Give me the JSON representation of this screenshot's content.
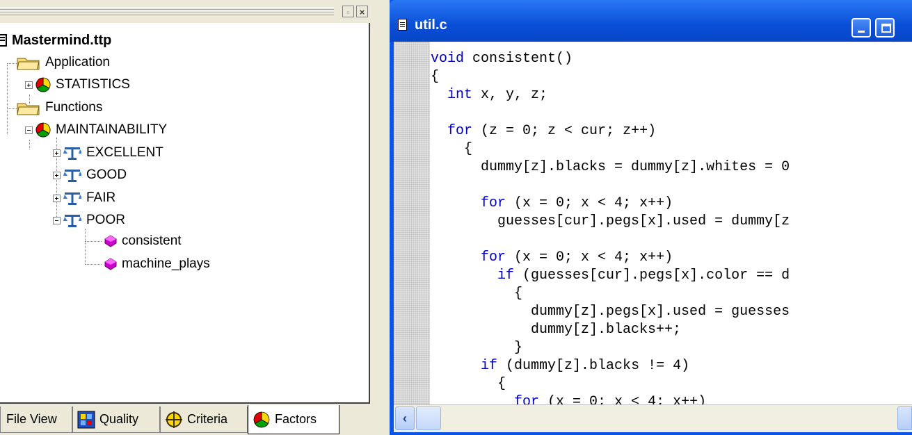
{
  "tree": {
    "root_label": "Mastermind.ttp",
    "items": [
      {
        "label": "Application"
      },
      {
        "label": "STATISTICS"
      },
      {
        "label": "Functions"
      },
      {
        "label": "MAINTAINABILITY"
      },
      {
        "label": "EXCELLENT"
      },
      {
        "label": "GOOD"
      },
      {
        "label": "FAIR"
      },
      {
        "label": "POOR"
      },
      {
        "label": "consistent"
      },
      {
        "label": "machine_plays"
      }
    ]
  },
  "tabs": [
    {
      "label": "File View"
    },
    {
      "label": "Quality"
    },
    {
      "label": "Criteria"
    },
    {
      "label": "Factors"
    }
  ],
  "editor": {
    "title": "util.c",
    "code_lines": [
      "void consistent()",
      "{",
      "  int x, y, z;",
      "",
      "  for (z = 0; z < cur; z++)",
      "    {",
      "      dummy[z].blacks = dummy[z].whites = 0",
      "",
      "      for (x = 0; x < 4; x++)",
      "        guesses[cur].pegs[x].used = dummy[z",
      "",
      "      for (x = 0; x < 4; x++)",
      "        if (guesses[cur].pegs[x].color == d",
      "          {",
      "            dummy[z].pegs[x].used = guesses",
      "            dummy[z].blacks++;",
      "          }",
      "      if (dummy[z].blacks != 4)",
      "        {",
      "          for (x = 0; x < 4; x++)"
    ],
    "keywords": [
      "void",
      "int",
      "for",
      "if"
    ]
  },
  "colors": {
    "keyword": "#0000c0",
    "titlebar": "#0a54e8",
    "factor_icon": [
      "#e00000",
      "#ffd800",
      "#00a000"
    ],
    "function_icon": "#cc00cc"
  }
}
